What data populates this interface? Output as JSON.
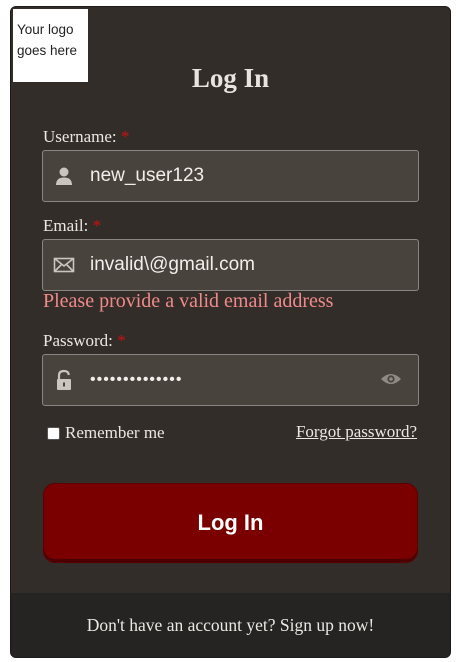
{
  "logo": {
    "line1": "Your logo",
    "line2": "goes here"
  },
  "title": "Log In",
  "required_marker": "*",
  "username": {
    "label": "Username:",
    "value": "new_user123",
    "icon": "user-icon"
  },
  "email": {
    "label": "Email:",
    "value": "invalid\\@gmail.com",
    "icon": "envelope-icon",
    "error": "Please provide a valid email address"
  },
  "password": {
    "label": "Password:",
    "value": "••••••••••••••",
    "icon": "lock-icon",
    "toggle_icon": "eye-icon"
  },
  "remember": {
    "label": "Remember me",
    "checked": false
  },
  "forgot_link": "Forgot password?",
  "login_button": "Log In",
  "signup_text": "Don't have an account yet? Sign up now!",
  "colors": {
    "error": "#f08a8a",
    "required": "#cc1111",
    "button": "#7a0000",
    "card": "#332d29"
  }
}
